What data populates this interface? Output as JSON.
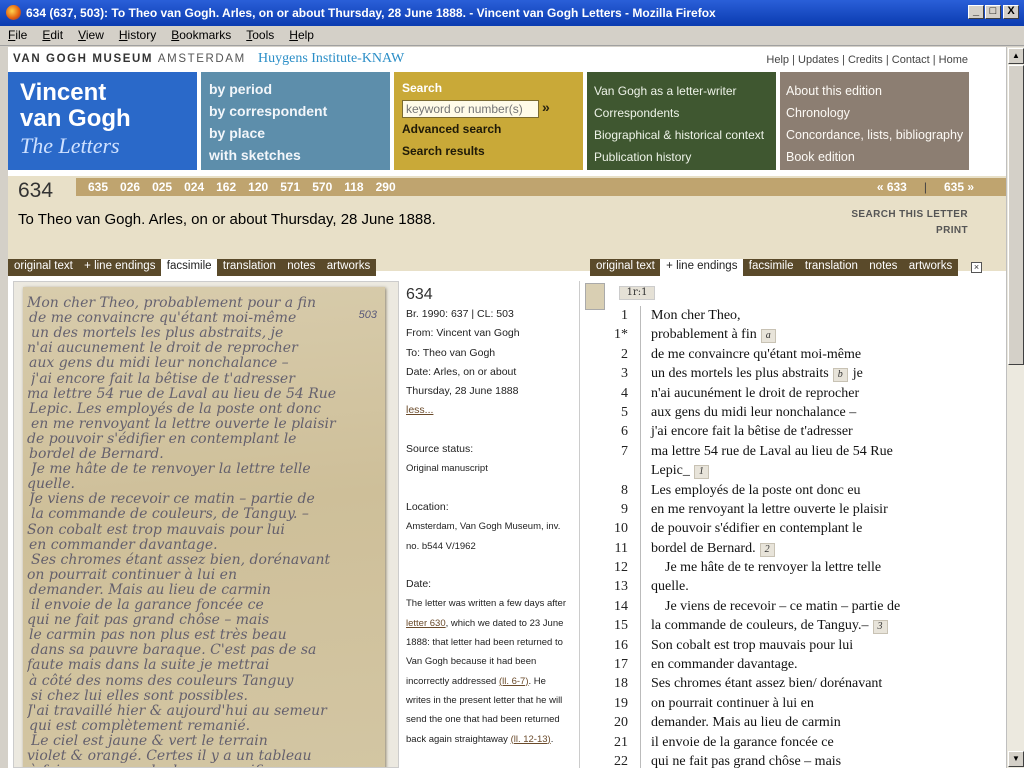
{
  "window": {
    "title": "634 (637, 503): To Theo van Gogh. Arles, on or about Thursday, 28 June 1888. - Vincent van Gogh Letters - Mozilla Firefox",
    "buttons": [
      "_",
      "□",
      "X"
    ]
  },
  "menu": [
    "File",
    "Edit",
    "View",
    "History",
    "Bookmarks",
    "Tools",
    "Help"
  ],
  "header": {
    "museum": "VAN GOGH MUSEUM",
    "city": "AMSTERDAM",
    "institute": "Huygens Institute-KNAW",
    "links": "Help | Updates | Credits | Contact | Home"
  },
  "brand": {
    "line1": "Vincent",
    "line2": "van Gogh",
    "line3": "The Letters"
  },
  "browse": [
    "by period",
    "by correspondent",
    "by place",
    "with sketches"
  ],
  "search": {
    "label": "Search",
    "placeholder": "keyword or number(s)",
    "go": "»",
    "advanced": "Advanced search",
    "results": "Search results"
  },
  "context": [
    "Van Gogh as a letter-writer",
    "Correspondents",
    "Biographical & historical context",
    "Publication history"
  ],
  "about": [
    "About this edition",
    "Chronology",
    "Concordance, lists, bibliography",
    "Book edition"
  ],
  "letter": {
    "number": "634",
    "related": [
      "635",
      "026",
      "025",
      "024",
      "162",
      "120",
      "571",
      "570",
      "118",
      "290"
    ],
    "prev": "« 633",
    "next": "635 »",
    "title": "To Theo van Gogh. Arles, on or about Thursday, 28 June 1888.",
    "search_letter": "SEARCH THIS LETTER",
    "print": "PRINT"
  },
  "left_tabs": [
    "original text",
    "+ line endings",
    "facsimile",
    "translation",
    "notes",
    "artworks"
  ],
  "right_tabs": [
    "original text",
    "+ line endings",
    "facsimile",
    "translation",
    "notes",
    "artworks"
  ],
  "close_icon": "×",
  "facsimile": {
    "page_mark": "503",
    "lines": [
      "Mon cher Theo, probablement pour a fin",
      "de me convaincre qu'étant moi-même",
      "un des mortels les plus abstraits, je",
      "n'ai aucunement le droit de reprocher",
      "aux gens du midi leur nonchalance –",
      "j'ai encore fait la bêtise de t'adresser",
      "ma lettre 54 rue de Laval au lieu de 54 Rue",
      "Lepic. Les employés de la poste ont donc",
      "en me renvoyant la lettre ouverte le plaisir",
      "de pouvoir s'édifier en contemplant le",
      "bordel de Bernard.",
      "Je me hâte de te renvoyer la lettre telle",
      "quelle.",
      "Je viens de recevoir ce matin – partie de",
      "la commande de couleurs, de Tanguy. –",
      "Son cobalt est trop mauvais pour lui",
      "en commander davantage.",
      "Ses chromes étant assez bien, dorénavant",
      "on pourrait continuer à lui en",
      "demander. Mais au lieu de carmin",
      "il envoie de la garance foncée ce",
      "qui ne fait pas grand chôse – mais",
      "le carmin pas non plus est très beau",
      "dans sa pauvre baraque. C'est pas de sa",
      "faute mais dans la suite je mettrai",
      "à côté des noms des couleurs Tanguy",
      "si chez lui elles sont possibles.",
      "J'ai travaillé hier & aujourd'hui au semeur",
      "qui est complètement remanié.",
      "Le ciel est jaune & vert le terrain",
      "violet & orangé. Certes il y a un tableau",
      "à faire comme cela de ce magnifique"
    ]
  },
  "meta": {
    "number": "634",
    "br": "Br. 1990: 637 | CL: 503",
    "from": "From: Vincent van Gogh",
    "to": "To: Theo van Gogh",
    "date1": "Date: Arles, on or about",
    "date2": "Thursday, 28 June 1888",
    "less": "less...",
    "source_label": "Source status:",
    "source_value": "Original manuscript",
    "location_label": "Location:",
    "location1": "Amsterdam, Van Gogh Museum, inv.",
    "location2": "no. b544 V/1962",
    "date_label": "Date:",
    "date_lines": [
      {
        "pre": "The letter was written a few days after",
        "link": "",
        "post": ""
      },
      {
        "pre": "",
        "link": "letter 630",
        "post": ", which we dated to 23 June"
      },
      {
        "pre": "1888: that letter had been returned to",
        "link": "",
        "post": ""
      },
      {
        "pre": "Van Gogh because it had been",
        "link": "",
        "post": ""
      },
      {
        "pre": "incorrectly addressed ",
        "link": "(ll. 6-7)",
        "post": ". He"
      },
      {
        "pre": "writes in the present letter that he will",
        "link": "",
        "post": ""
      },
      {
        "pre": "send the one that had been returned",
        "link": "",
        "post": ""
      },
      {
        "pre": "back again straightaway ",
        "link": "(ll. 12-13)",
        "post": "."
      }
    ]
  },
  "original": {
    "page_ref": "1r:1",
    "lines": [
      {
        "no": "1",
        "text": "Mon cher Theo,",
        "note": ""
      },
      {
        "no": "1*",
        "text": "probablement à fin",
        "note": "a"
      },
      {
        "no": "2",
        "text": "de me convaincre qu'étant moi-même",
        "note": ""
      },
      {
        "no": "3",
        "text": "un des mortels les plus abstraits",
        "note": "b",
        "after": "je"
      },
      {
        "no": "4",
        "text": "n'ai aucunément le droit de reprocher",
        "note": ""
      },
      {
        "no": "5",
        "text": "aux gens du midi leur nonchalance –",
        "note": ""
      },
      {
        "no": "6",
        "text": "j'ai encore fait la bêtise de t'adresser",
        "note": ""
      },
      {
        "no": "7",
        "text": "ma lettre 54 rue de Laval au lieu de 54 Rue",
        "note": ""
      },
      {
        "no": "",
        "text": "Lepic_",
        "note": "1"
      },
      {
        "no": "8",
        "text": "Les employés de la poste ont donc eu",
        "note": ""
      },
      {
        "no": "9",
        "text": "en me renvoyant la lettre ouverte le plaisir",
        "note": ""
      },
      {
        "no": "10",
        "text": "de pouvoir s'édifier en contemplant le",
        "note": ""
      },
      {
        "no": "11",
        "text": "bordel de Bernard.",
        "note": "2"
      },
      {
        "no": "12",
        "text": "    Je me hâte de te renvoyer la lettre telle",
        "note": ""
      },
      {
        "no": "13",
        "text": "quelle.",
        "note": ""
      },
      {
        "no": "14",
        "text": "    Je viens de recevoir – ce matin – partie de",
        "note": ""
      },
      {
        "no": "15",
        "text": "la commande de couleurs, de Tanguy.–",
        "note": "3"
      },
      {
        "no": "16",
        "text": "Son cobalt est trop mauvais pour lui",
        "note": ""
      },
      {
        "no": "17",
        "text": "en commander davantage.",
        "note": ""
      },
      {
        "no": "18",
        "text": "Ses chromes étant assez bien/ dorénavant",
        "note": ""
      },
      {
        "no": "19",
        "text": "on pourrait continuer à lui en",
        "note": ""
      },
      {
        "no": "20",
        "text": "demander. Mais au lieu de carmin",
        "note": ""
      },
      {
        "no": "21",
        "text": "il envoie de la garance foncée ce",
        "note": ""
      },
      {
        "no": "22",
        "text": "qui ne fait pas grand chôse – mais",
        "note": ""
      }
    ]
  }
}
